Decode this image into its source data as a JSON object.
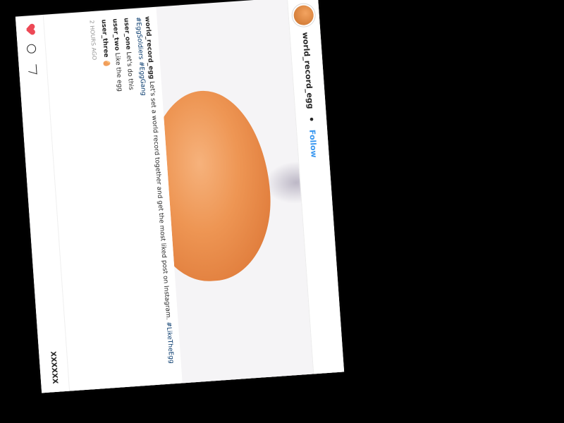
{
  "post": {
    "username": "world_record_egg",
    "follow_label": "Follow",
    "likes": "XXXXXX",
    "caption_user": "world_record_egg",
    "caption_text": "Let's set a world record together and get the most liked post on Instagram.",
    "hashtags": "#LikeTheEgg #EggSoldiers #EggGang",
    "comments": [
      {
        "user": "user_one",
        "text": "Let's do this"
      },
      {
        "user": "user_two",
        "text": "Like the egg"
      },
      {
        "user": "user_three",
        "text": "🥚"
      }
    ],
    "time_ago": "2 HOURS AGO"
  },
  "icons": {
    "heart": "heart-icon",
    "comment": "comment-icon",
    "share": "share-icon",
    "avatar": "egg-avatar"
  },
  "colors": {
    "egg": "#ee9654",
    "like": "#ed4956",
    "link": "#3897f0",
    "background": "#000000"
  }
}
